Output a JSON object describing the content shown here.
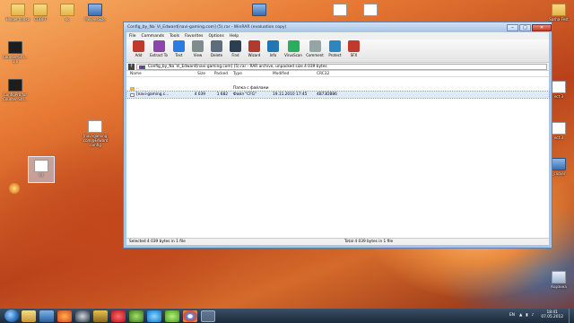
{
  "desktop": {
    "icons": [
      {
        "label": "Новая папка",
        "type": "folder"
      },
      {
        "label": "СПОРТ",
        "type": "folder"
      },
      {
        "label": "кс",
        "type": "folder"
      },
      {
        "label": "MoveesSize",
        "type": "pc"
      },
      {
        "label": "Counter-Stri... 1.6",
        "type": "cs"
      },
      {
        "label": "ConfigPro for Counter-Stri...",
        "type": "cs"
      },
      {
        "label": "[navi-gaming .com@Edward .config",
        "type": "doc"
      },
      {
        "label": "!!!",
        "type": "doc"
      }
    ],
    "right_labels": [
      "Sasha Fest",
      "ect 3",
      "ect 3",
      "ect 3",
      "_clicker",
      "ect 3",
      "Корзина"
    ]
  },
  "window": {
    "title": "Config_by_Na`Vi_Edward[navi-gaming.com] (5).rar - WinRAR (evaluation copy)",
    "menu": [
      "File",
      "Commands",
      "Tools",
      "Favorites",
      "Options",
      "Help"
    ],
    "toolbar": [
      {
        "label": "Add",
        "color": "#c0392b"
      },
      {
        "label": "Extract To",
        "color": "#8e44ad"
      },
      {
        "label": "Test",
        "color": "#2c7be5"
      },
      {
        "label": "View",
        "color": "#7f8c8d"
      },
      {
        "label": "Delete",
        "color": "#5d6d7e"
      },
      {
        "label": "Find",
        "color": "#2c3e50"
      },
      {
        "label": "Wizard",
        "color": "#b03a2e"
      },
      {
        "label": "Info",
        "color": "#1f77b4"
      },
      {
        "label": "VirusScan",
        "color": "#27ae60"
      },
      {
        "label": "Comment",
        "color": "#95a5a6"
      },
      {
        "label": "Protect",
        "color": "#2e86c1"
      },
      {
        "label": "SFX",
        "color": "#c0392b"
      }
    ],
    "address": "Config_by_Na`Vi_Edward[navi-gaming.com] (5).rar - RAR archive, unpacked size 4 039 bytes",
    "columns": {
      "name": "Name",
      "size": "Size",
      "packed": "Packed",
      "type": "Type",
      "modified": "Modified",
      "crc": "CRC32"
    },
    "rows": [
      {
        "name": "..",
        "size": "",
        "packed": "",
        "type": "Папка с файлами",
        "modified": "",
        "crc": "",
        "selected": false
      },
      {
        "name": "[navi-gaming.c...",
        "size": "4 039",
        "packed": "1 682",
        "type": "Файл \"CFG\"",
        "modified": "19.11.2010 17:45",
        "crc": "4B73DB86",
        "selected": true
      }
    ],
    "status_left": "Selected 4 039 bytes in 1 file",
    "status_right": "Total 4 039 bytes in 1 file"
  },
  "taskbar": {
    "apps": [
      "explorer",
      "media-player",
      "firefox",
      "steam",
      "game",
      "opera",
      "utorrent",
      "skype",
      "qip",
      "chrome",
      "winrar"
    ],
    "lang": "EN",
    "time": "18:41",
    "date": "07.05.2012"
  }
}
